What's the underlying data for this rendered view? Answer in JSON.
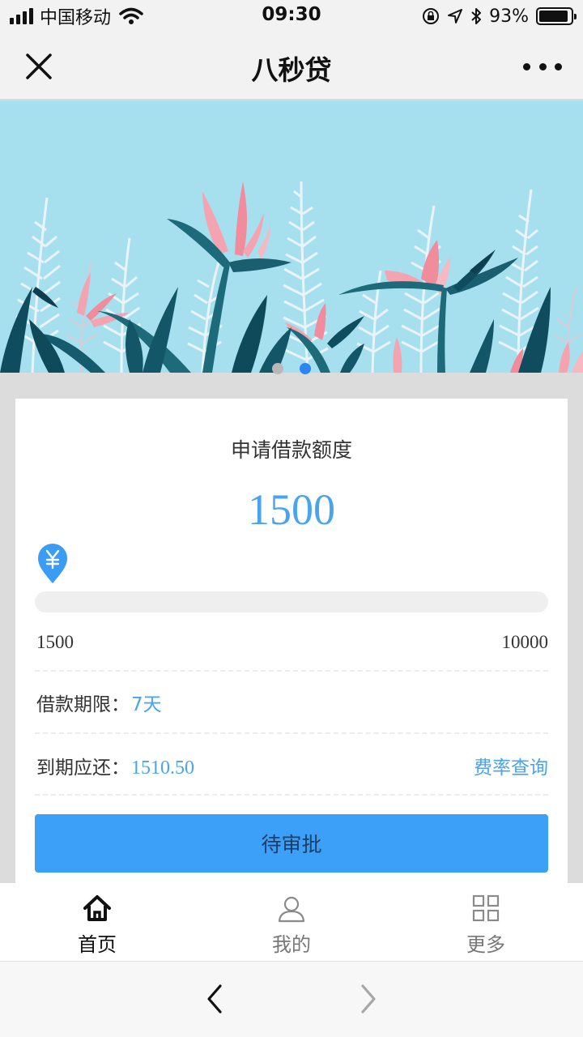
{
  "status_bar": {
    "carrier": "中国移动",
    "time": "09:30",
    "battery": "93%",
    "battery_level": 0.93,
    "icons": [
      "signal-icon",
      "wifi-icon",
      "orientation-lock-icon",
      "location-icon",
      "bluetooth-icon",
      "battery-icon"
    ]
  },
  "nav": {
    "title": "八秒贷",
    "close_icon": "close-icon",
    "more_icon": "more-icon"
  },
  "banner": {
    "page_count": 2,
    "active_page": 2
  },
  "loan": {
    "title": "申请借款额度",
    "amount": "1500",
    "currency_icon": "yuan-pin-icon",
    "min": "1500",
    "max": "10000",
    "slider_value": 1500,
    "term_label": "借款期限：",
    "term_value": "7天",
    "due_label": "到期应还：",
    "due_value": "1510.50",
    "rate_link": "费率查询",
    "submit_label": "待审批"
  },
  "tabs": [
    {
      "label": "首页",
      "icon": "home-icon",
      "active": true
    },
    {
      "label": "我的",
      "icon": "user-icon",
      "active": false
    },
    {
      "label": "更多",
      "icon": "grid-icon",
      "active": false
    }
  ],
  "browser": {
    "back_icon": "chevron-left-icon",
    "forward_icon": "chevron-right-icon"
  },
  "colors": {
    "accent": "#4aa3ee",
    "button": "#3da0f8",
    "banner_sky": "#a6e0ef",
    "leaf_dark": "#1d6a7a",
    "flower_pink": "#f4a4b0"
  }
}
